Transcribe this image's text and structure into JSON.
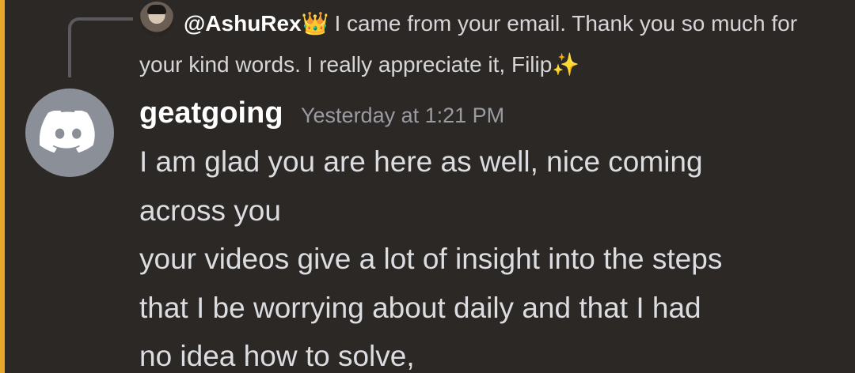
{
  "reply": {
    "username": "@AshuRex",
    "username_emoji": "👑",
    "text": "I came from your email.  Thank you so much for your kind words.  I really appreciate it, Filip",
    "trailing_emoji": "✨"
  },
  "message": {
    "username": "geatgoing",
    "timestamp": "Yesterday at 1:21 PM",
    "lines": [
      "I am glad you are here as well, nice coming",
      "across you",
      "your videos give a lot of insight into the steps",
      "that I be worrying about daily and that I had",
      "no idea how to solve,"
    ]
  },
  "colors": {
    "background": "#2c2826",
    "accent_edge": "#e6a82b",
    "avatar_bg": "#8b8f98",
    "username": "#ffffff",
    "timestamp": "#9a9ca2",
    "message_text": "#dcdde0"
  },
  "icons": {
    "main_avatar": "discord-logo-icon",
    "reply_avatar": "user-photo-avatar"
  }
}
